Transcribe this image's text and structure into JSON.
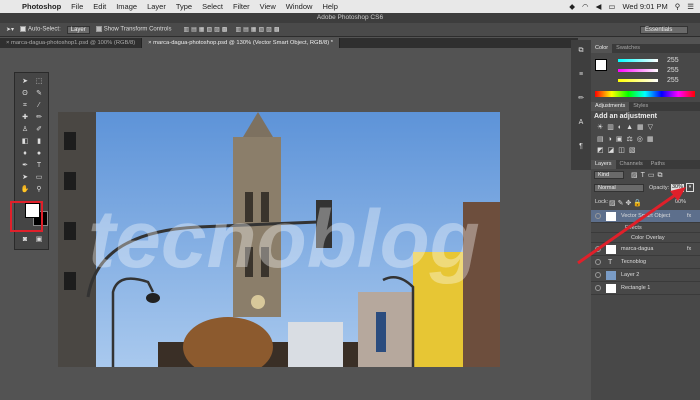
{
  "menubar": {
    "app": "Photoshop",
    "items": [
      "File",
      "Edit",
      "Image",
      "Layer",
      "Type",
      "Select",
      "Filter",
      "View",
      "Window",
      "Help"
    ],
    "clock": "Wed 9:01 PM"
  },
  "title": "Adobe Photoshop CS6",
  "options": {
    "auto_select": "Auto-Select:",
    "layer_select": "Layer",
    "show_transform": "Show Transform Controls",
    "workspace": "Essentials"
  },
  "tabs": [
    "marca-dagua-photoshop1.psd @ 100% (RGB/8)",
    "marca-dagua-photoshop.psd @ 130% (Vector Smart Object, RGB/8) *"
  ],
  "watermark": "tecnoblog",
  "color_panel": {
    "tabs": [
      "Color",
      "Swatches"
    ],
    "values": [
      "255",
      "255",
      "255"
    ]
  },
  "adjustments": {
    "tabs": [
      "Adjustments",
      "Styles"
    ],
    "heading": "Add an adjustment"
  },
  "layers_panel": {
    "tabs": [
      "Layers",
      "Channels",
      "Paths"
    ],
    "filter": "Kind",
    "blend": "Normal",
    "opacity_label": "Opacity:",
    "opacity": "30%",
    "lock_label": "Lock:",
    "fill": "00%",
    "layers": [
      {
        "name": "Vector Smart Object",
        "selected": true
      },
      {
        "name": "Effects"
      },
      {
        "name": "Color Overlay"
      },
      {
        "name": "marca-dagua"
      },
      {
        "name": "Tecnoblog"
      },
      {
        "name": "Layer 2"
      },
      {
        "name": "Rectangle 1"
      }
    ]
  },
  "colors": {
    "highlight": "#e0202a",
    "sky": "#7faee6"
  }
}
